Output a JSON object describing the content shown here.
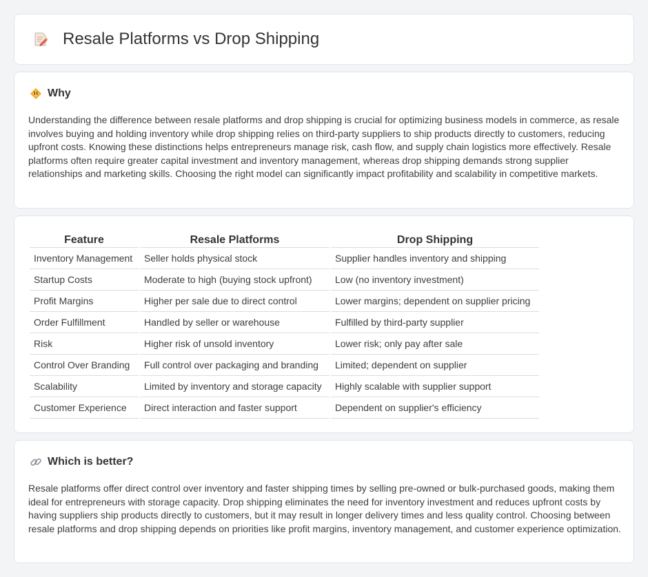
{
  "header": {
    "title": "Resale Platforms vs Drop Shipping",
    "icon": "document-pencil-icon"
  },
  "why": {
    "title": "Why",
    "icon": "diamond-warning-icon",
    "text": "Understanding the difference between resale platforms and drop shipping is crucial for optimizing business models in commerce, as resale involves buying and holding inventory while drop shipping relies on third-party suppliers to ship products directly to customers, reducing upfront costs. Knowing these distinctions helps entrepreneurs manage risk, cash flow, and supply chain logistics more effectively. Resale platforms often require greater capital investment and inventory management, whereas drop shipping demands strong supplier relationships and marketing skills. Choosing the right model can significantly impact profitability and scalability in competitive markets."
  },
  "table": {
    "headers": [
      "Feature",
      "Resale Platforms",
      "Drop Shipping"
    ],
    "rows": [
      [
        "Inventory Management",
        "Seller holds physical stock",
        "Supplier handles inventory and shipping"
      ],
      [
        "Startup Costs",
        "Moderate to high (buying stock upfront)",
        "Low (no inventory investment)"
      ],
      [
        "Profit Margins",
        "Higher per sale due to direct control",
        "Lower margins; dependent on supplier pricing"
      ],
      [
        "Order Fulfillment",
        "Handled by seller or warehouse",
        "Fulfilled by third-party supplier"
      ],
      [
        "Risk",
        "Higher risk of unsold inventory",
        "Lower risk; only pay after sale"
      ],
      [
        "Control Over Branding",
        "Full control over packaging and branding",
        "Limited; dependent on supplier"
      ],
      [
        "Scalability",
        "Limited by inventory and storage capacity",
        "Highly scalable with supplier support"
      ],
      [
        "Customer Experience",
        "Direct interaction and faster support",
        "Dependent on supplier's efficiency"
      ]
    ]
  },
  "better": {
    "title": "Which is better?",
    "icon": "link-icon",
    "text": "Resale platforms offer direct control over inventory and faster shipping times by selling pre-owned or bulk-purchased goods, making them ideal for entrepreneurs with storage capacity. Drop shipping eliminates the need for inventory investment and reduces upfront costs by having suppliers ship products directly to customers, but it may result in longer delivery times and less quality control. Choosing between resale platforms and drop shipping depends on priorities like profit margins, inventory management, and customer experience optimization."
  }
}
